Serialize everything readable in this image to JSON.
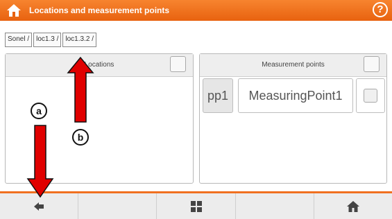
{
  "header": {
    "title": "Locations and measurement points",
    "help_symbol": "?",
    "color": "#f07020"
  },
  "breadcrumb": [
    "Sonel /",
    "loc1.3 /",
    "loc1.3.2 /"
  ],
  "locations_panel": {
    "title": "Locations",
    "select_all_checked": false
  },
  "measurement_panel": {
    "title": "Measurement points",
    "select_all_checked": false,
    "items": [
      {
        "id": "pp1",
        "name": "MeasuringPoint1",
        "checked": false
      }
    ]
  },
  "toolbar": {
    "buttons": [
      "back-icon",
      "",
      "grid-icon",
      "",
      "home-icon"
    ]
  },
  "annotations": [
    {
      "label": "a",
      "color": "#e00000"
    },
    {
      "label": "b",
      "color": "#e00000"
    }
  ]
}
